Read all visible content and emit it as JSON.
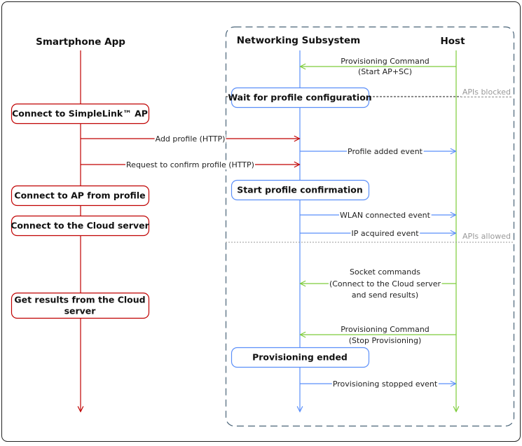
{
  "colors": {
    "app": "#c00000",
    "networking": "#5b8ff9",
    "host": "#7dcc3a",
    "frame": "#4a6478",
    "api_line": "#777777"
  },
  "lifelines": [
    {
      "id": "app",
      "title": "Smartphone App"
    },
    {
      "id": "networking",
      "title": "Networking Subsystem"
    },
    {
      "id": "host",
      "title": "Host"
    }
  ],
  "activity_boxes": [
    {
      "lane": "app",
      "lines": [
        "Connect to SimpleLink™ AP"
      ]
    },
    {
      "lane": "app",
      "lines": [
        "Connect to AP from profile"
      ]
    },
    {
      "lane": "app",
      "lines": [
        "Connect to the Cloud server"
      ]
    },
    {
      "lane": "app",
      "lines": [
        "Get results from the Cloud",
        "server"
      ]
    },
    {
      "lane": "networking",
      "lines": [
        "Wait for profile configuration"
      ]
    },
    {
      "lane": "networking",
      "lines": [
        "Start profile confirmation"
      ]
    },
    {
      "lane": "networking",
      "lines": [
        "Provisioning ended"
      ]
    }
  ],
  "messages": [
    {
      "from": "host",
      "to": "networking",
      "lines": [
        "Provisioning Command",
        "(Start AP+SC)"
      ]
    },
    {
      "from": "app",
      "to": "networking",
      "lines": [
        "Add profile (HTTP)"
      ]
    },
    {
      "from": "networking",
      "to": "host",
      "lines": [
        "Profile added event"
      ]
    },
    {
      "from": "app",
      "to": "networking",
      "lines": [
        "Request to confirm profile (HTTP)"
      ]
    },
    {
      "from": "networking",
      "to": "host",
      "lines": [
        "WLAN connected event"
      ]
    },
    {
      "from": "networking",
      "to": "host",
      "lines": [
        "IP acquired event"
      ]
    },
    {
      "from": "host",
      "to": "networking",
      "lines": [
        "Socket commands",
        "(Connect to the Cloud server",
        "and send results)"
      ]
    },
    {
      "from": "host",
      "to": "networking",
      "lines": [
        "Provisioning Command",
        "(Stop Provisioning)"
      ]
    },
    {
      "from": "networking",
      "to": "host",
      "lines": [
        "Provisioning stopped event"
      ]
    }
  ],
  "api_states": [
    {
      "label": "APIs blocked"
    },
    {
      "label": "APIs allowed"
    }
  ]
}
